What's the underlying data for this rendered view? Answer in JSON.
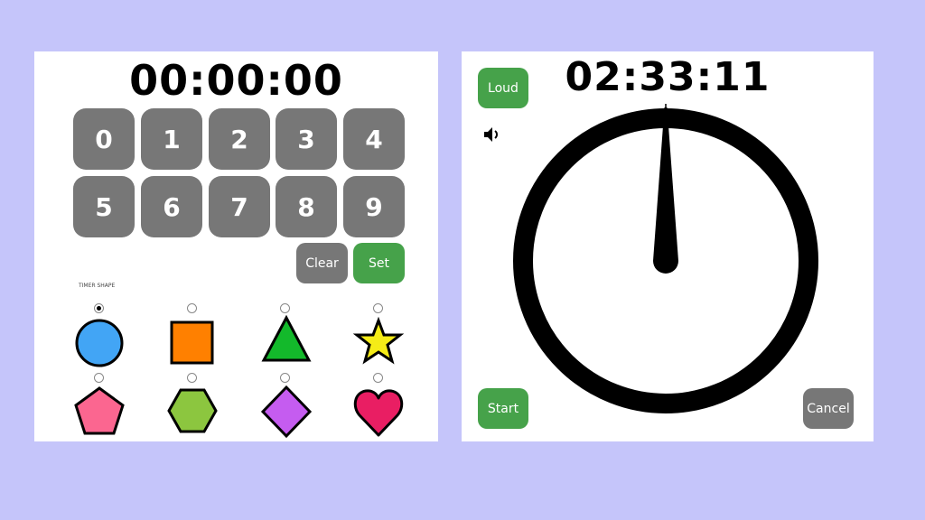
{
  "setter": {
    "display": "00:00:00",
    "keys": [
      "0",
      "1",
      "2",
      "3",
      "4",
      "5",
      "6",
      "7",
      "8",
      "9"
    ],
    "clear_label": "Clear",
    "set_label": "Set",
    "shape_section_label": "TIMER SHAPE",
    "shapes": [
      {
        "name": "circle",
        "color": "#42a5f5",
        "selected": true
      },
      {
        "name": "square",
        "color": "#ff8000",
        "selected": false
      },
      {
        "name": "triangle",
        "color": "#13b92b",
        "selected": false
      },
      {
        "name": "star",
        "color": "#f5ec17",
        "selected": false
      },
      {
        "name": "pentagon",
        "color": "#fb6690",
        "selected": false
      },
      {
        "name": "hexagon",
        "color": "#8cc63f",
        "selected": false
      },
      {
        "name": "diamond",
        "color": "#c55cf0",
        "selected": false
      },
      {
        "name": "heart",
        "color": "#e91e63",
        "selected": false
      }
    ]
  },
  "timer": {
    "display": "02:33:11",
    "loud_label": "Loud",
    "sound_icon": "speaker-icon",
    "start_label": "Start",
    "cancel_label": "Cancel",
    "dial_hand_fraction": 0.0
  },
  "colors": {
    "background": "#c5c5fa",
    "panel": "#ffffff",
    "button_gray": "#777777",
    "button_green": "#46a24a"
  }
}
